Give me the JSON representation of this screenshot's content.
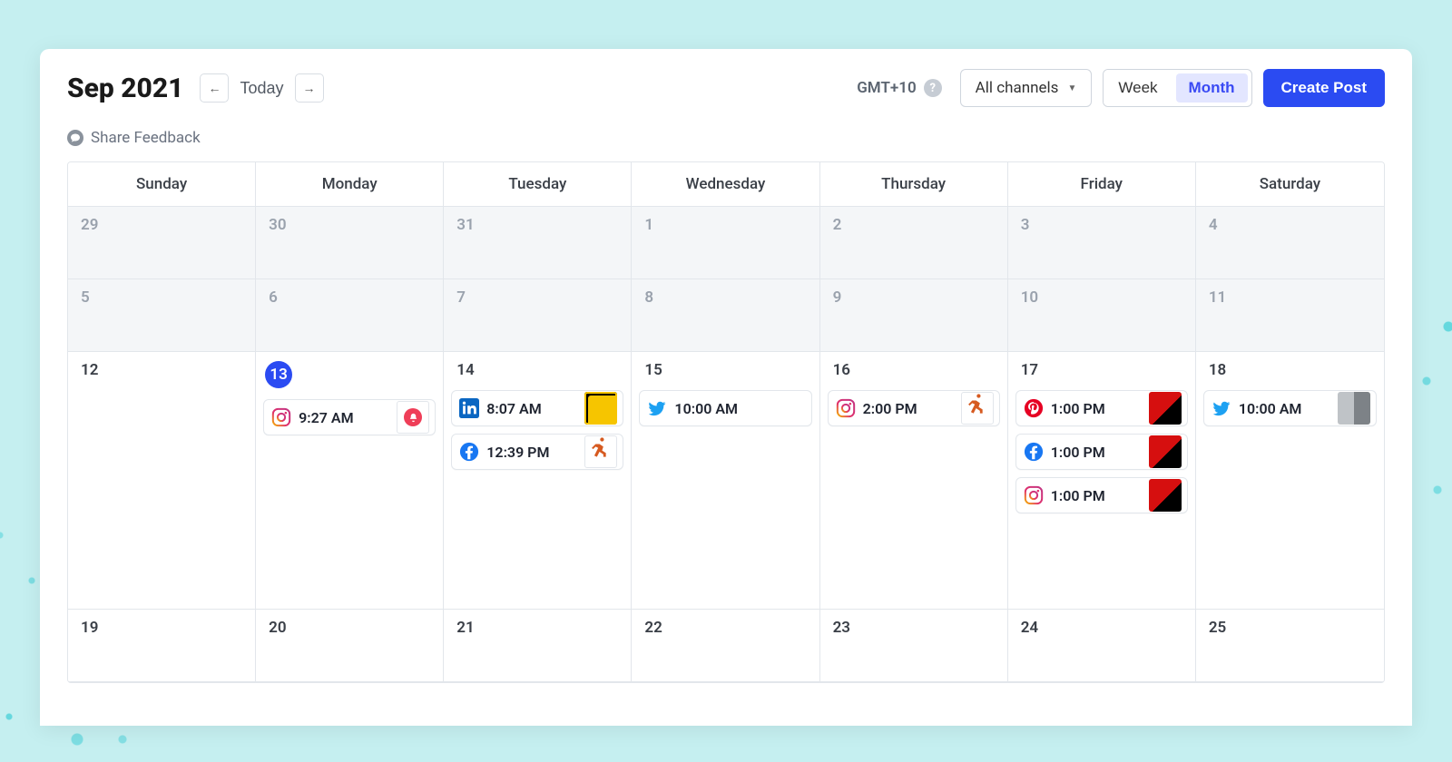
{
  "header": {
    "month_title": "Sep 2021",
    "today_label": "Today",
    "timezone": "GMT+10",
    "channels_dropdown": "All channels",
    "view_week": "Week",
    "view_month": "Month",
    "create_post": "Create Post",
    "active_view": "Month"
  },
  "feedback": {
    "label": "Share Feedback"
  },
  "dow": [
    "Sunday",
    "Monday",
    "Tuesday",
    "Wednesday",
    "Thursday",
    "Friday",
    "Saturday"
  ],
  "weeks": [
    {
      "big": false,
      "days": [
        {
          "num": "29",
          "dim": true,
          "today": false,
          "events": []
        },
        {
          "num": "30",
          "dim": true,
          "today": false,
          "events": []
        },
        {
          "num": "31",
          "dim": true,
          "today": false,
          "events": []
        },
        {
          "num": "1",
          "dim": true,
          "today": false,
          "events": []
        },
        {
          "num": "2",
          "dim": true,
          "today": false,
          "events": []
        },
        {
          "num": "3",
          "dim": true,
          "today": false,
          "events": []
        },
        {
          "num": "4",
          "dim": true,
          "today": false,
          "events": []
        }
      ]
    },
    {
      "big": false,
      "days": [
        {
          "num": "5",
          "dim": true,
          "today": false,
          "events": []
        },
        {
          "num": "6",
          "dim": true,
          "today": false,
          "events": []
        },
        {
          "num": "7",
          "dim": true,
          "today": false,
          "events": []
        },
        {
          "num": "8",
          "dim": true,
          "today": false,
          "events": []
        },
        {
          "num": "9",
          "dim": true,
          "today": false,
          "events": []
        },
        {
          "num": "10",
          "dim": true,
          "today": false,
          "events": []
        },
        {
          "num": "11",
          "dim": true,
          "today": false,
          "events": []
        }
      ]
    },
    {
      "big": true,
      "days": [
        {
          "num": "12",
          "dim": false,
          "today": false,
          "events": []
        },
        {
          "num": "13",
          "dim": false,
          "today": true,
          "events": [
            {
              "channel": "instagram",
              "time": "9:27 AM",
              "thumb": "badge-white"
            }
          ]
        },
        {
          "num": "14",
          "dim": false,
          "today": false,
          "events": [
            {
              "channel": "linkedin",
              "time": "8:07 AM",
              "thumb": "yellow"
            },
            {
              "channel": "facebook",
              "time": "12:39 PM",
              "thumb": "runner-white"
            }
          ]
        },
        {
          "num": "15",
          "dim": false,
          "today": false,
          "events": [
            {
              "channel": "twitter",
              "time": "10:00 AM",
              "thumb": "none"
            }
          ]
        },
        {
          "num": "16",
          "dim": false,
          "today": false,
          "events": [
            {
              "channel": "instagram",
              "time": "2:00 PM",
              "thumb": "runner-white"
            }
          ]
        },
        {
          "num": "17",
          "dim": false,
          "today": false,
          "events": [
            {
              "channel": "pinterest",
              "time": "1:00 PM",
              "thumb": "red"
            },
            {
              "channel": "facebook",
              "time": "1:00 PM",
              "thumb": "red"
            },
            {
              "channel": "instagram",
              "time": "1:00 PM",
              "thumb": "red"
            }
          ]
        },
        {
          "num": "18",
          "dim": false,
          "today": false,
          "events": [
            {
              "channel": "twitter",
              "time": "10:00 AM",
              "thumb": "gray"
            }
          ]
        }
      ]
    },
    {
      "big": false,
      "days": [
        {
          "num": "19",
          "dim": false,
          "today": false,
          "events": []
        },
        {
          "num": "20",
          "dim": false,
          "today": false,
          "events": []
        },
        {
          "num": "21",
          "dim": false,
          "today": false,
          "events": []
        },
        {
          "num": "22",
          "dim": false,
          "today": false,
          "events": []
        },
        {
          "num": "23",
          "dim": false,
          "today": false,
          "events": []
        },
        {
          "num": "24",
          "dim": false,
          "today": false,
          "events": []
        },
        {
          "num": "25",
          "dim": false,
          "today": false,
          "events": []
        }
      ]
    }
  ]
}
